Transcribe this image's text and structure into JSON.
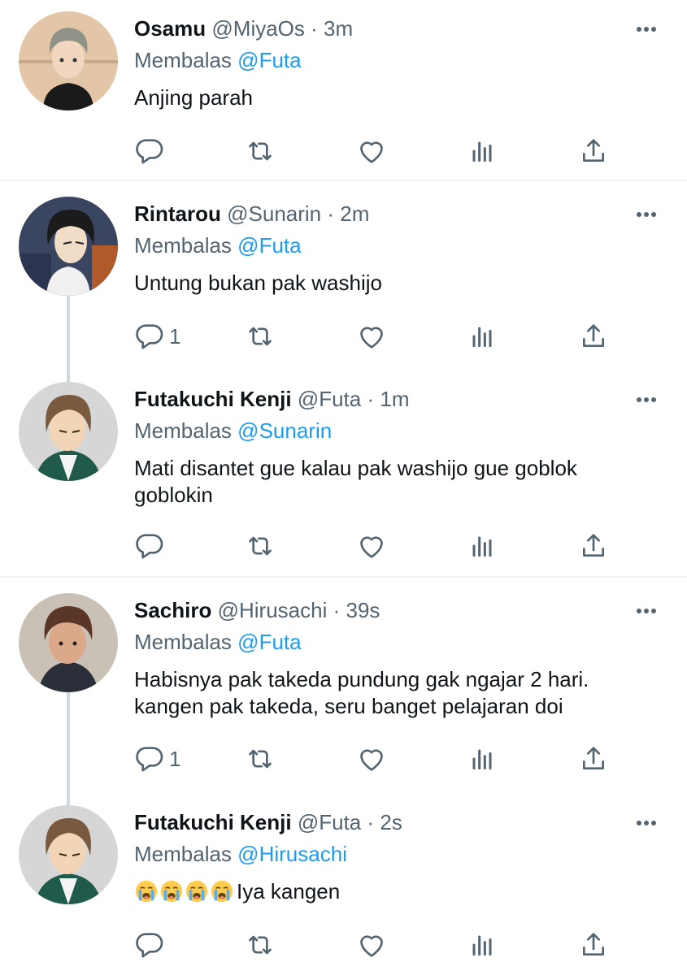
{
  "colors": {
    "text": "#0f1419",
    "secondary": "#536471",
    "link": "#1d9bf0",
    "thread_line": "#cfd9de",
    "divider": "#eff3f4"
  },
  "tweets": [
    {
      "name": "Osamu",
      "handle": "@MiyaOs",
      "dot": "·",
      "time": "3m",
      "replying_prefix": "Membalas",
      "replying_to": "@Futa",
      "text": "Anjing parah",
      "reply_count": "",
      "avatar_icon": "avatar-osamu"
    },
    {
      "name": "Rintarou",
      "handle": "@Sunarin",
      "dot": "·",
      "time": "2m",
      "replying_prefix": "Membalas",
      "replying_to": "@Futa",
      "text": "Untung bukan pak washijo",
      "reply_count": "1",
      "avatar_icon": "avatar-rintarou"
    },
    {
      "name": "Futakuchi Kenji",
      "handle": "@Futa",
      "dot": "·",
      "time": "1m",
      "replying_prefix": "Membalas",
      "replying_to": "@Sunarin",
      "text_lines": [
        "Mati disantet gue kalau pak washijo gue goblok",
        "goblokin"
      ],
      "reply_count": "",
      "avatar_icon": "avatar-futakuchi"
    },
    {
      "name": "Sachiro",
      "handle": "@Hirusachi",
      "dot": "·",
      "time": "39s",
      "replying_prefix": "Membalas",
      "replying_to": "@Futa",
      "text_lines": [
        "Habisnya pak takeda pundung gak ngajar 2 hari.",
        "kangen pak takeda, seru banget pelajaran doi"
      ],
      "reply_count": "1",
      "avatar_icon": "avatar-sachiro"
    },
    {
      "name": "Futakuchi Kenji",
      "handle": "@Futa",
      "dot": "·",
      "time": "2s",
      "replying_prefix": "Membalas",
      "replying_to": "@Hirusachi",
      "emoji_icon": "loudly-crying-face-emoji",
      "emoji_count": 4,
      "text": "Iya kangen",
      "reply_count": "",
      "avatar_icon": "avatar-futakuchi"
    }
  ],
  "action_icons": [
    "reply-icon",
    "retweet-icon",
    "like-icon",
    "views-icon",
    "share-icon"
  ],
  "more_icon": "more-options-icon"
}
